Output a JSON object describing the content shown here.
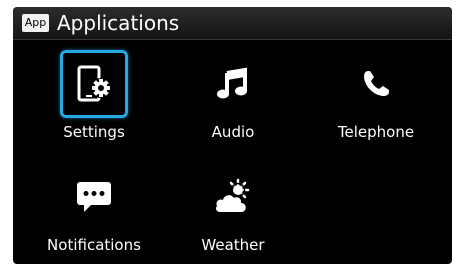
{
  "window": {
    "badge": "App",
    "title": "Applications"
  },
  "apps": [
    {
      "label": "Settings",
      "icon": "settings-icon",
      "selected": true
    },
    {
      "label": "Audio",
      "icon": "music-note-icon",
      "selected": false
    },
    {
      "label": "Telephone",
      "icon": "phone-icon",
      "selected": false
    },
    {
      "label": "Notifications",
      "icon": "chat-bubble-icon",
      "selected": false
    },
    {
      "label": "Weather",
      "icon": "weather-icon",
      "selected": false
    }
  ],
  "colors": {
    "background": "#000000",
    "text": "#ffffff",
    "selection": "#29a7e3"
  }
}
